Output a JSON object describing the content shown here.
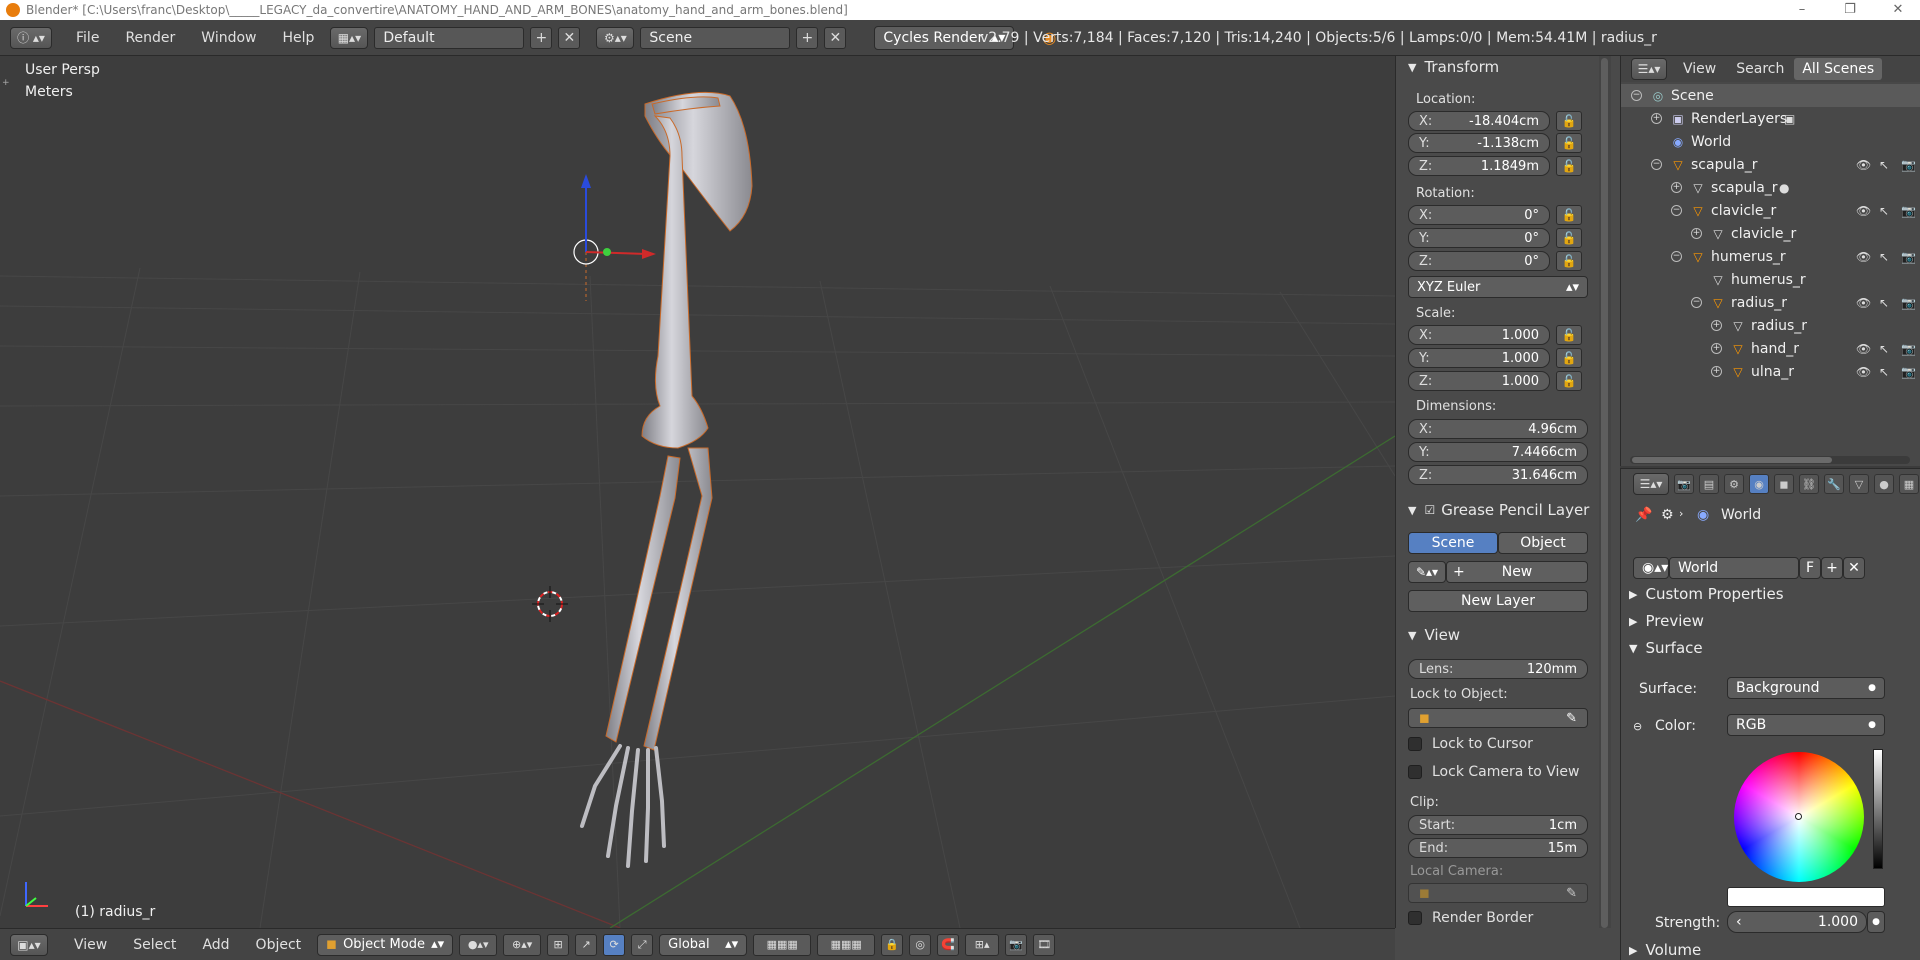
{
  "window": {
    "title": "Blender* [C:\\Users\\franc\\Desktop\\_____LEGACY_da_convertire\\ANATOMY_HAND_AND_ARM_BONES\\anatomy_hand_and_arm_bones.blend]"
  },
  "menubar": {
    "items": [
      "File",
      "Render",
      "Window",
      "Help"
    ],
    "layout": "Default",
    "scene": "Scene",
    "engine": "Cycles Render"
  },
  "stats": "v2.79 | Verts:7,184 | Faces:7,120 | Tris:14,240 | Objects:5/6 | Lamps:0/0 | Mem:54.41M | radius_r",
  "viewport": {
    "view_name": "User Persp",
    "units": "Meters",
    "active_object": "(1) radius_r"
  },
  "npanel": {
    "transform_title": "Transform",
    "location_label": "Location:",
    "location": [
      {
        "k": "X:",
        "v": "-18.404cm"
      },
      {
        "k": "Y:",
        "v": "-1.138cm"
      },
      {
        "k": "Z:",
        "v": "1.1849m"
      }
    ],
    "rotation_label": "Rotation:",
    "rotation": [
      {
        "k": "X:",
        "v": "0°"
      },
      {
        "k": "Y:",
        "v": "0°"
      },
      {
        "k": "Z:",
        "v": "0°"
      }
    ],
    "rotation_mode": "XYZ Euler",
    "scale_label": "Scale:",
    "scale": [
      {
        "k": "X:",
        "v": "1.000"
      },
      {
        "k": "Y:",
        "v": "1.000"
      },
      {
        "k": "Z:",
        "v": "1.000"
      }
    ],
    "dimensions_label": "Dimensions:",
    "dimensions": [
      {
        "k": "X:",
        "v": "4.96cm"
      },
      {
        "k": "Y:",
        "v": "7.4466cm"
      },
      {
        "k": "Z:",
        "v": "31.646cm"
      }
    ],
    "grease_title": "Grease Pencil Layer",
    "grease_scene": "Scene",
    "grease_object": "Object",
    "grease_new": "New",
    "grease_new_layer": "New Layer",
    "view_title": "View",
    "lens_label": "Lens:",
    "lens_value": "120mm",
    "lock_object_label": "Lock to Object:",
    "lock_cursor": "Lock to Cursor",
    "lock_camera": "Lock Camera to View",
    "clip_label": "Clip:",
    "clip_start_k": "Start:",
    "clip_start_v": "1cm",
    "clip_end_k": "End:",
    "clip_end_v": "15m",
    "local_camera": "Local Camera:",
    "render_border": "Render Border"
  },
  "outliner": {
    "header": {
      "view": "View",
      "search": "Search",
      "scope": "All Scenes"
    },
    "rows": [
      {
        "name": "Scene"
      },
      {
        "name": "RenderLayers"
      },
      {
        "name": "World"
      },
      {
        "name": "scapula_r"
      },
      {
        "name": "scapula_r"
      },
      {
        "name": "clavicle_r"
      },
      {
        "name": "clavicle_r"
      },
      {
        "name": "humerus_r"
      },
      {
        "name": "humerus_r"
      },
      {
        "name": "radius_r"
      },
      {
        "name": "radius_r"
      },
      {
        "name": "hand_r"
      },
      {
        "name": "ulna_r"
      }
    ]
  },
  "properties": {
    "breadcrumb": "World",
    "world_name": "World",
    "fake_user": "F",
    "sections": {
      "custom": "Custom Properties",
      "preview": "Preview",
      "surface": "Surface",
      "volume": "Volume"
    },
    "surface_label": "Surface:",
    "surface_value": "Background",
    "color_label": "Color:",
    "color_value": "RGB",
    "strength_label": "Strength:",
    "strength_value": "1.000"
  },
  "bottombar": {
    "view": "View",
    "select": "Select",
    "add": "Add",
    "object": "Object",
    "mode": "Object Mode",
    "orientation": "Global"
  }
}
